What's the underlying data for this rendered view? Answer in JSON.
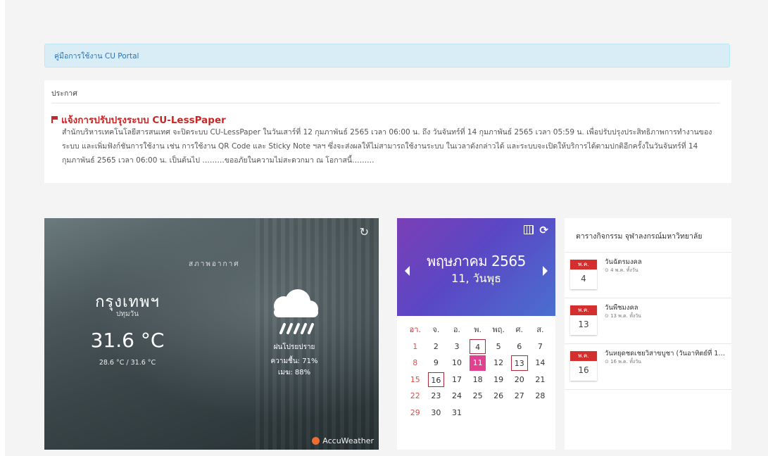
{
  "manual": {
    "link_text": "คู่มือการใช้งาน CU Portal"
  },
  "announcement": {
    "heading": "ประกาศ",
    "title": "แจ้งการปรับปรุงระบบ CU-LessPaper",
    "body": "สำนักบริหารเทคโนโลยีสารสนเทศ จะปิดระบบ CU-LessPaper ในวันเสาร์ที่ 12 กุมภาพันธ์ 2565 เวลา 06:00 น. ถึง วันจันทร์ที่ 14 กุมภาพันธ์ 2565 เวลา 05:59 น. เพื่อปรับปรุงประสิทธิภาพการทำงานของระบบ และเพิ่มฟังก์ชันการใช้งาน เช่น การใช้งาน QR Code และ Sticky Note ฯลฯ ซึ่งจะส่งผลให้ไม่สามารถใช้งานระบบ ในเวลาดังกล่าวได้ และระบบจะเปิดให้บริการได้ตามปกติอีกครั้งในวันจันทร์ที่ 14 กุมภาพันธ์ 2565 เวลา 06:00 น. เป็นต้นไป ………ขออภัยในความไม่สะดวกมา ณ โอกาสนี้………"
  },
  "weather": {
    "label": "สภาพอากาศ",
    "city": "กรุงเทพฯ",
    "district": "ปทุมวัน",
    "temperature": "31.6 °C",
    "range": "28.6 °C / 31.6 °C",
    "condition": "ฝนโปรยปราย",
    "humidity": "ความชื้น: 71%",
    "cloud": "เมฆ: 88%",
    "provider": "AccuWeather",
    "refresh_icon": "refresh-icon",
    "condition_icon": "rain-cloud-icon"
  },
  "calendar": {
    "month_year": "พฤษภาคม 2565",
    "day_label": "11, วันพุธ",
    "weekdays": [
      "อา.",
      "จ.",
      "อ.",
      "พ.",
      "พฤ.",
      "ศ.",
      "ส."
    ],
    "weeks": [
      [
        "1",
        "2",
        "3",
        "4",
        "5",
        "6",
        "7"
      ],
      [
        "8",
        "9",
        "10",
        "11",
        "12",
        "13",
        "14"
      ],
      [
        "15",
        "16",
        "17",
        "18",
        "19",
        "20",
        "21"
      ],
      [
        "22",
        "23",
        "24",
        "25",
        "26",
        "27",
        "28"
      ],
      [
        "29",
        "30",
        "31",
        "",
        "",
        "",
        ""
      ]
    ],
    "today": "11",
    "marked_days": [
      "4",
      "13",
      "16"
    ],
    "accent_color": "#e0428f",
    "mark_color": "#b0293b"
  },
  "events": {
    "title": "ตารางกิจกรรม จุฬาลงกรณ์มหาวิทยาลัย",
    "items": [
      {
        "month": "พ.ค.",
        "day": "4",
        "name": "วันฉัตรมงคล",
        "time": "⊙ 4 พ.ค. ทั้งวัน"
      },
      {
        "month": "พ.ค.",
        "day": "13",
        "name": "วันพืชมงคล",
        "time": "⊙ 13 พ.ค. ทั้งวัน"
      },
      {
        "month": "พ.ค.",
        "day": "16",
        "name": "วันหยุดชดเชยวิสาขบูชา (วันอาทิตย์ที่ 15 ...",
        "time": "⊙ 16 พ.ค. ทั้งวัน"
      }
    ]
  }
}
